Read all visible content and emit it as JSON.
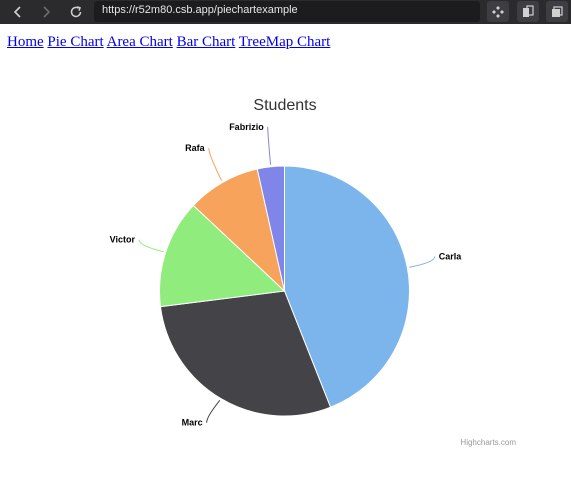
{
  "browser": {
    "url": "https://r52m80.csb.app/piechartexample"
  },
  "nav": {
    "links": [
      "Home",
      "Pie Chart",
      "Area Chart",
      "Bar Chart",
      "TreeMap Chart"
    ]
  },
  "chart_data": {
    "type": "pie",
    "title": "Students",
    "credits": "Highcharts.com",
    "series": [
      {
        "name": "Carla",
        "value": 44,
        "color": "#7cb5ec"
      },
      {
        "name": "Marc",
        "value": 29,
        "color": "#434348"
      },
      {
        "name": "Victor",
        "value": 14,
        "color": "#90ed7d"
      },
      {
        "name": "Rafa",
        "value": 9.5,
        "color": "#f7a35c"
      },
      {
        "name": "Fabrizio",
        "value": 3.5,
        "color": "#8085e9"
      }
    ]
  }
}
